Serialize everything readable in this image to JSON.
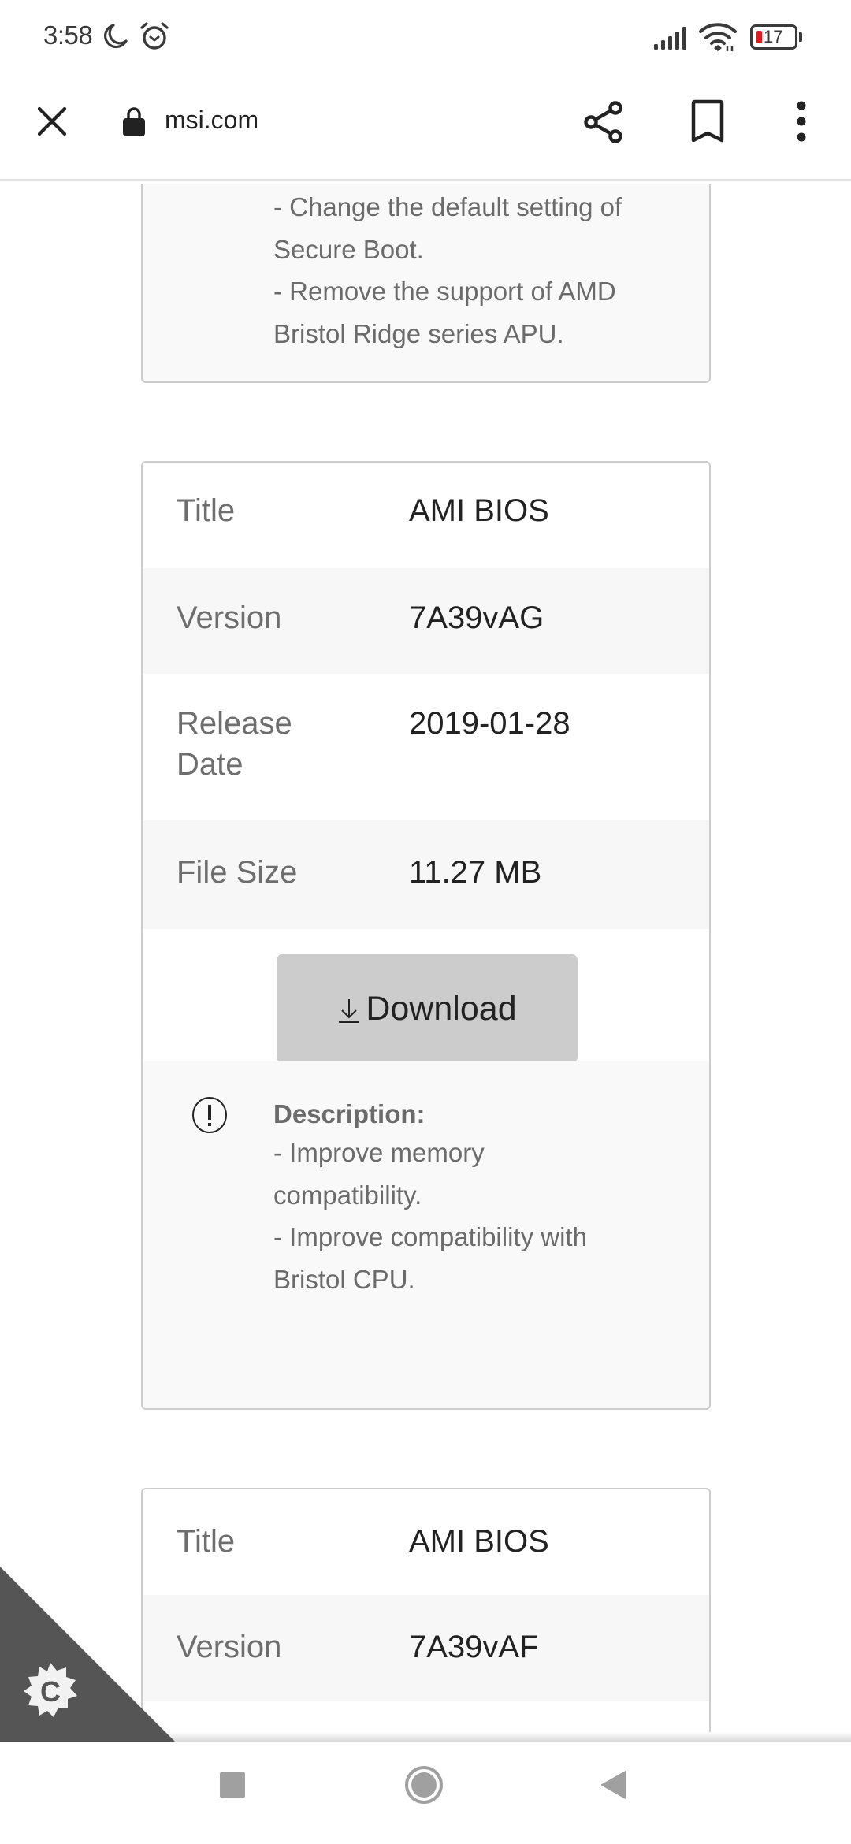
{
  "status_bar": {
    "time": "3:58",
    "battery_level": "17",
    "icons": [
      "moon-icon",
      "alarm-icon",
      "signal-icon",
      "wifi-icon",
      "battery-icon"
    ]
  },
  "toolbar": {
    "url": "msi.com",
    "icons": [
      "close-icon",
      "lock-icon",
      "share-icon",
      "bookmark-icon",
      "more-vert-icon"
    ]
  },
  "previous_card": {
    "description_lines": [
      "- Change the default setting of",
      "Secure Boot.",
      "- Remove the support of AMD",
      "Bristol Ridge series APU."
    ]
  },
  "bios_card": {
    "rows": [
      {
        "label": "Title",
        "value": "AMI BIOS"
      },
      {
        "label": "Version",
        "value": "7A39vAG"
      },
      {
        "label": "Release Date",
        "value": "2019-01-28"
      },
      {
        "label": "File Size",
        "value": "11.27 MB"
      }
    ],
    "release_label_lines": [
      "Release",
      "Date"
    ],
    "download_label": "Download",
    "description_title": "Description:",
    "description_lines": [
      "- Improve memory",
      "compatibility.",
      "- Improve compatibility with",
      "Bristol CPU."
    ]
  },
  "next_card": {
    "rows": [
      {
        "label": "Title",
        "value": "AMI BIOS"
      },
      {
        "label": "Version",
        "value": "7A39vAF"
      }
    ]
  },
  "corner_badge": {
    "letter": "C",
    "color": "#555555"
  },
  "colors": {
    "row_alt_bg": "#f7f7f7",
    "button_bg": "#cccccc",
    "battery_low": "#e0191f"
  }
}
